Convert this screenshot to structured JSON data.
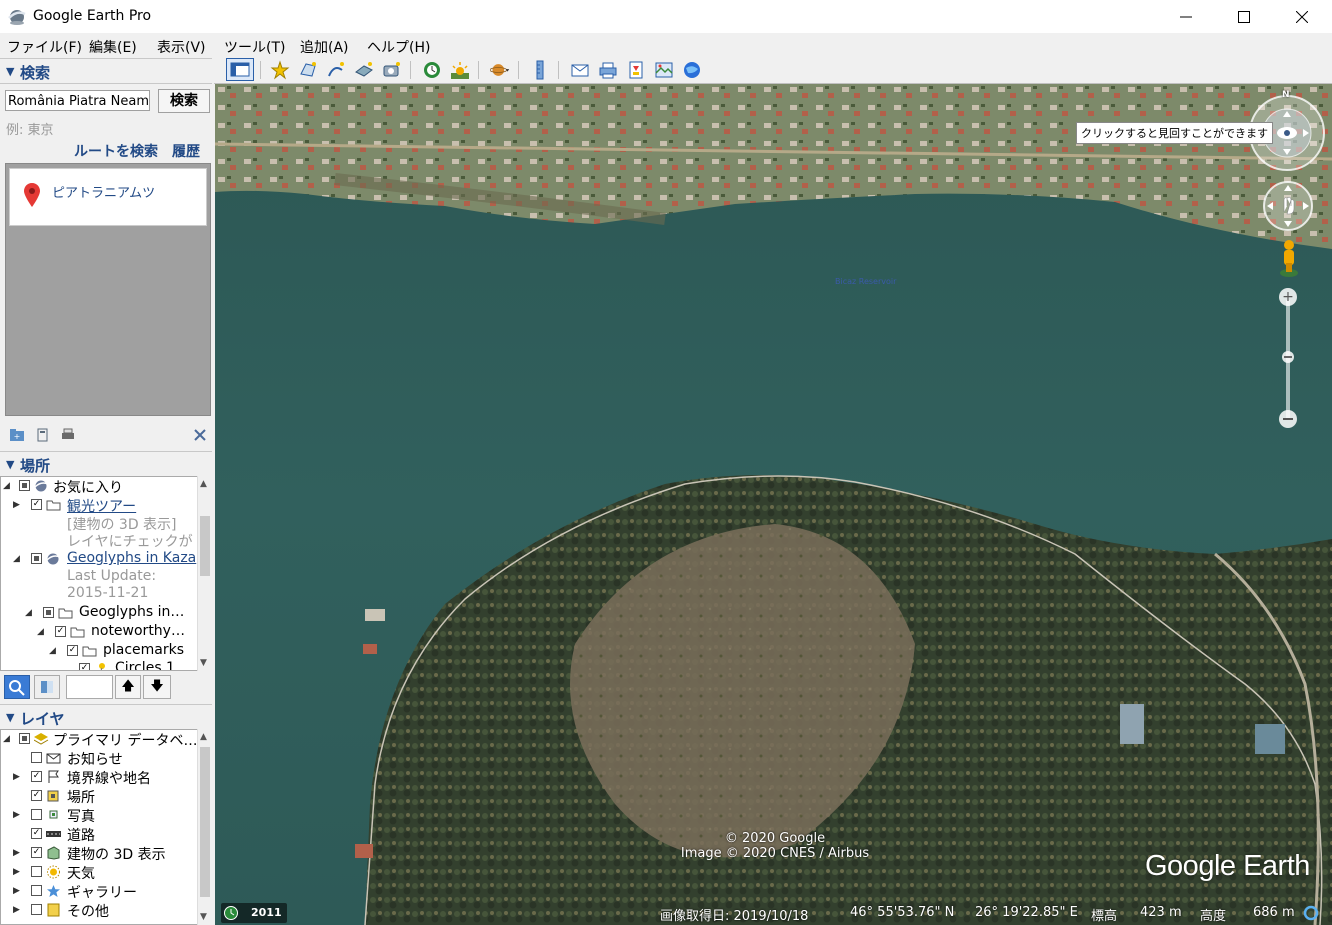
{
  "window": {
    "title": "Google Earth Pro",
    "minimize_label": "—",
    "maximize_label": "☐",
    "close_label": "✕"
  },
  "menu": [
    "ファイル(F)",
    "編集(E)",
    "表示(V)",
    "ツール(T)",
    "追加(A)",
    "ヘルプ(H)"
  ],
  "search": {
    "header": "検索",
    "input_value": "România  Piatra Neamț",
    "button": "検索",
    "hint": "例: 東京",
    "route_link": "ルートを検索",
    "history_link": "履歴",
    "result": "ピアトラニアムツ"
  },
  "places": {
    "header": "場所",
    "rows": [
      {
        "label": "お気に入り",
        "link": false
      },
      {
        "label": "観光ツアー",
        "link": true
      },
      {
        "label": "[建物の 3D 表示]",
        "link": false,
        "muted": true
      },
      {
        "label": "レイヤにチェックが",
        "link": false,
        "muted": true
      },
      {
        "label": "Geoglyphs in Kaza",
        "link": true
      },
      {
        "label": "Last Update:",
        "link": false,
        "muted": true
      },
      {
        "label": "2015-11-21",
        "link": false,
        "muted": true
      },
      {
        "label": "Geoglyphs in…",
        "link": false
      },
      {
        "label": "noteworthy…",
        "link": false
      },
      {
        "label": "placemarks",
        "link": false
      },
      {
        "label": "Circles 1",
        "link": false
      }
    ]
  },
  "layers": {
    "header": "レイヤ",
    "rows": [
      {
        "label": "プライマリ データベ…"
      },
      {
        "label": "お知らせ"
      },
      {
        "label": "境界線や地名"
      },
      {
        "label": "場所"
      },
      {
        "label": "写真"
      },
      {
        "label": "道路"
      },
      {
        "label": "建物の 3D 表示"
      },
      {
        "label": "天気"
      },
      {
        "label": "ギャラリー"
      },
      {
        "label": "その他"
      }
    ]
  },
  "map": {
    "tooltip": "クリックすると見回すことができます",
    "compass_n": "N",
    "place_label": "Bicaz Reservoir",
    "copyright_1": "© 2020 Google",
    "copyright_2": "Image © 2020 CNES / Airbus",
    "logo": "Google Earth",
    "year": "2011",
    "status": {
      "date": "画像取得日: 2019/10/18",
      "lat": "46°  55'53.76\" N",
      "lon": "26°  19'22.85\" E",
      "elev_label": "標高",
      "elev_value": "423 m",
      "alt_label": "高度",
      "alt_value": "686 m"
    }
  },
  "colors": {
    "accent_blue": "#224a86",
    "water": "#2f5a58"
  }
}
